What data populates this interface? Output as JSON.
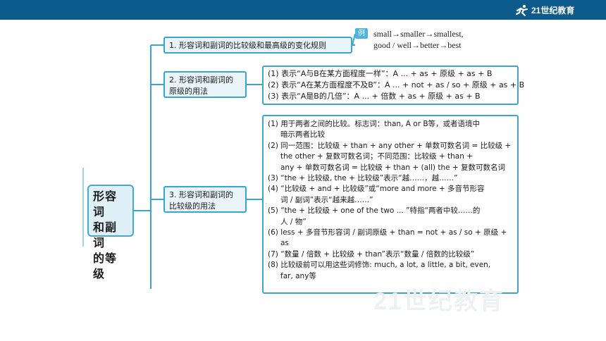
{
  "header": {
    "logo_text": "21世纪教育"
  },
  "center_node": {
    "lines": [
      "形容词",
      "和副词",
      "的等级"
    ]
  },
  "branches": {
    "b1": {
      "label": "1. 形容词和副词的比较级和最高级的变化规则"
    },
    "b2": {
      "label_lines": [
        "2. 形容词和副词的",
        "原级的用法"
      ]
    },
    "b3": {
      "label_lines": [
        "3. 形容词和副词的",
        "比较级的用法"
      ]
    }
  },
  "example": {
    "badge": "例",
    "lines": [
      "small→smaller→smallest,",
      "good / well→better→best"
    ]
  },
  "detail2": {
    "lines": [
      "(1) 表示“A与B在某方面程度一样”：A ... + as + 原级 + as + B",
      "(2) 表示“A在某方面程度不及B”：A ... + not + as / so + 原级 + as + B",
      "(3) 表示“A是B的几倍”：A ... + 倍数 + as + 原级 + as + B"
    ]
  },
  "detail3": {
    "lines": [
      {
        "text": "(1) 用于两者之间的比较。标志词：than, A or B等，或者语境中",
        "indent": false
      },
      {
        "text": "暗示两者比较",
        "indent": true
      },
      {
        "text": "(2) 同一范围：比较级 + than + any other + 单数可数名词 = 比较级 +",
        "indent": false
      },
      {
        "text": "the other + 复数可数名词；不同范围：比较级 + than +",
        "indent": true
      },
      {
        "text": "any + 单数可数名词 = 比较级 + than + (all) the + 复数可数名词",
        "indent": true
      },
      {
        "text": "(3) “the + 比较级, the + 比较级”表示“越……，越……”",
        "indent": false
      },
      {
        "text": "(4) “比较级 + and + 比较级”或“more and more + 多音节形容",
        "indent": false
      },
      {
        "text": "词 / 副词”表示“越来越……”",
        "indent": true
      },
      {
        "text": "(5) “the + 比较级 + one of the two ... ”特指“两者中较……的",
        "indent": false
      },
      {
        "text": "人 / 物”",
        "indent": true
      },
      {
        "text": "(6) less + 多音节形容词 / 副词原级 + than = not + as / so + 原级 +",
        "indent": false
      },
      {
        "text": "as",
        "indent": true
      },
      {
        "text": "(7) “数量 / 倍数 + 比较级 + than”表示“数量 / 倍数的比较级”",
        "indent": false
      },
      {
        "text": "(8) 比较级前可以用这些词修饰: much, a lot, a little, a bit, even,",
        "indent": false
      },
      {
        "text": "far, any等",
        "indent": true
      }
    ]
  },
  "colors": {
    "header_bar": "#0c5b8c",
    "node_border": "#3aa6cf",
    "node_fill": "#eaf5fb",
    "connector": "#3aa6cf"
  }
}
